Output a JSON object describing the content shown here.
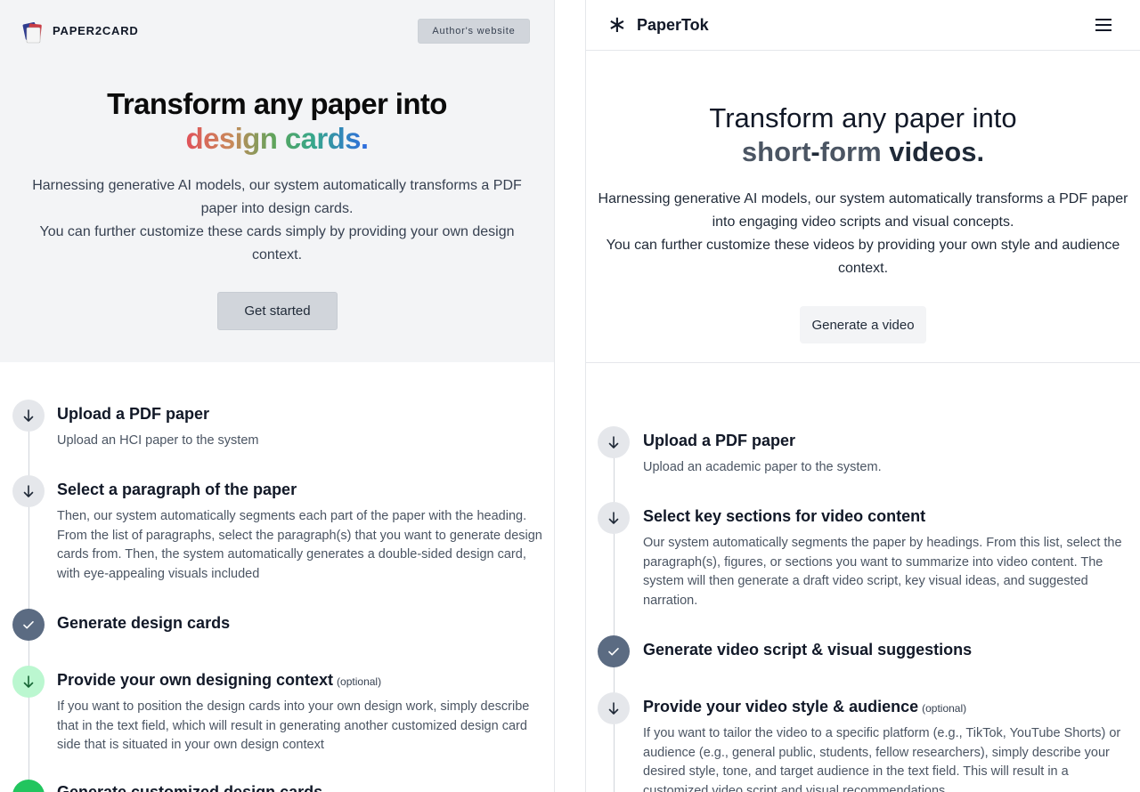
{
  "left": {
    "brand": "PAPER2CARD",
    "author_button": "Author's website",
    "hero": {
      "title_line1": "Transform any paper into",
      "title_line2": "design cards.",
      "desc_line1": "Harnessing generative AI models, our system automatically transforms a PDF paper into design cards.",
      "desc_line2": "You can further customize these cards simply by providing your own design context.",
      "cta": "Get started"
    },
    "steps": [
      {
        "title": "Upload a PDF paper",
        "desc": "Upload an HCI paper to the system",
        "icon": "arrow-down-icon"
      },
      {
        "title": "Select a paragraph of the paper",
        "desc": "Then, our system automatically segments each part of the paper with the heading. From the list of paragraphs, select the paragraph(s) that you want to generate design cards from. Then, the system automatically generates a double-sided design card, with eye-appealing visuals included",
        "icon": "arrow-down-icon"
      },
      {
        "title": "Generate design cards",
        "icon": "check-icon"
      },
      {
        "title": "Provide your own designing context",
        "optional": "(optional)",
        "desc": "If you want to position the design cards into your own design work, simply describe that in the text field, which will result in generating another customized design card side that is situated in your own design context",
        "icon": "arrow-down-icon"
      },
      {
        "title": "Generate customized design cards",
        "icon": "check-icon"
      }
    ]
  },
  "right": {
    "brand": "PaperTok",
    "hero": {
      "title_line1": "Transform any paper into",
      "title_short": "short",
      "title_dash": "-",
      "title_form": "form",
      "title_videos": " videos.",
      "desc_line1": "Harnessing generative AI models, our system automatically transforms a PDF paper into engaging video scripts and visual concepts.",
      "desc_line2": "You can further customize these videos by providing your own style and audience context.",
      "cta": "Generate a video"
    },
    "steps": [
      {
        "title": "Upload a PDF paper",
        "desc": "Upload an academic paper to the system.",
        "icon": "arrow-down-icon"
      },
      {
        "title": "Select key sections for video content",
        "desc": "Our system automatically segments the paper by headings. From this list, select the paragraph(s), figures, or sections you want to summarize into video content. The system will then generate a draft video script, key visual ideas, and suggested narration.",
        "icon": "arrow-down-icon"
      },
      {
        "title": "Generate video script & visual suggestions",
        "icon": "check-icon"
      },
      {
        "title": "Provide your video style & audience",
        "optional": "(optional)",
        "desc": "If you want to tailor the video to a specific platform (e.g., TikTok, YouTube Shorts) or audience (e.g., general public, students, fellow researchers), simply describe your desired style, tone, and target audience in the text field. This will result in a customized video script and visual recommendations.",
        "icon": "arrow-down-icon"
      }
    ]
  },
  "colors": {
    "hero_bg": "#f3f4f6",
    "button_gray": "#d1d5db",
    "check_slate": "#5b6b82",
    "optional_green": "#bbf7d0"
  }
}
